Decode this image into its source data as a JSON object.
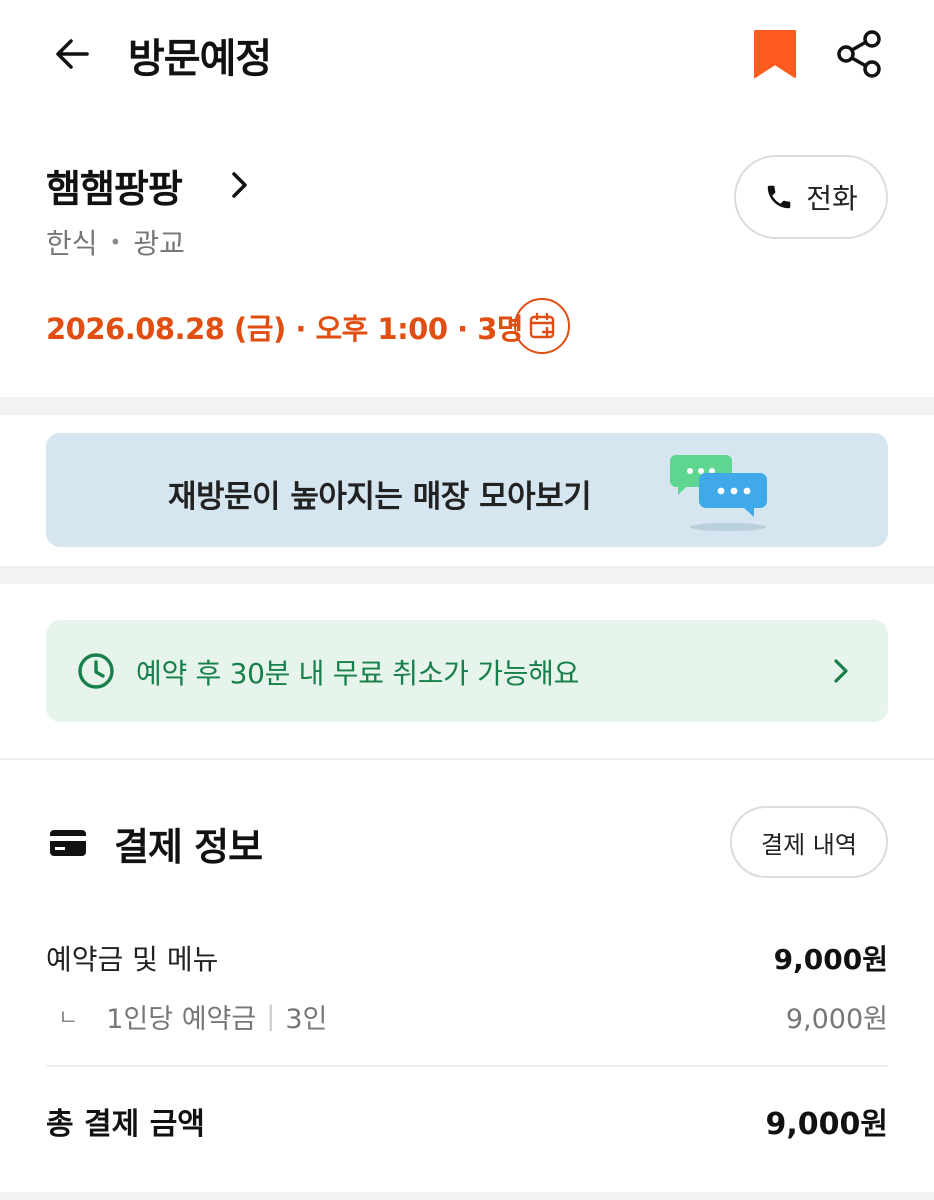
{
  "header": {
    "title": "방문예정",
    "accent_color": "#ff5a1f"
  },
  "store": {
    "name": "햄햄팡팡",
    "category": "한식",
    "area": "광교",
    "call_label": "전화"
  },
  "reservation": {
    "summary": "2026.08.28 (금) · 오후 1:00 · 3명",
    "color": "#e04e12"
  },
  "banner": {
    "text": "재방문이 높아지는 매장 모아보기"
  },
  "notice": {
    "text": "예약 후 30분 내 무료 취소가 가능해요",
    "color": "#17804a"
  },
  "payment": {
    "title": "결제 정보",
    "history_label": "결제 내역",
    "items_label": "예약금 및 메뉴",
    "items_amount": "9,000원",
    "sub_corner": "ㄴ",
    "sub_label": "1인당 예약금",
    "sub_count": "3인",
    "sub_amount": "9,000원",
    "total_label": "총 결제 금액",
    "total_amount": "9,000원"
  }
}
